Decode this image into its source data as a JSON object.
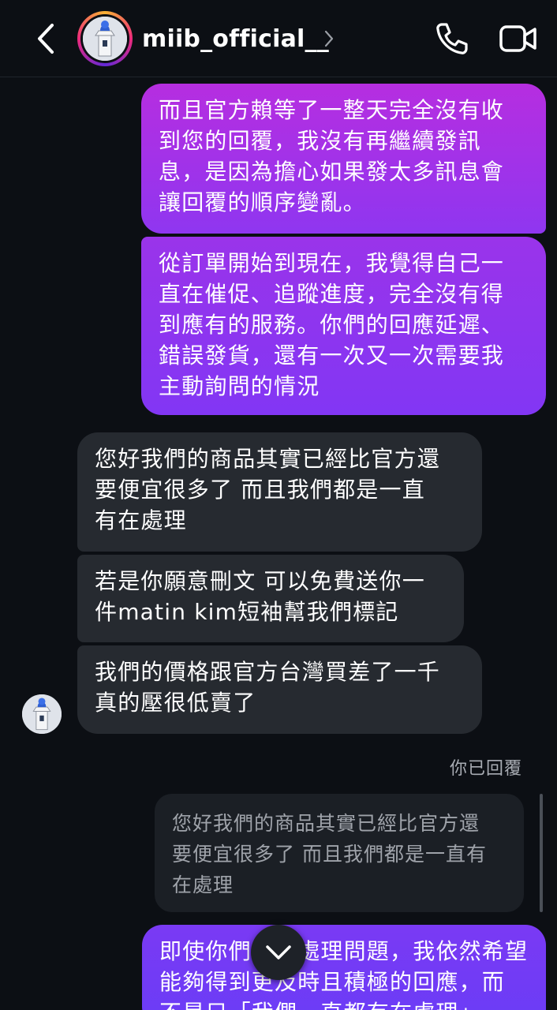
{
  "header": {
    "username": "miib_official__",
    "icons": {
      "back": "back-chevron-icon",
      "profile": "chevron-right-icon",
      "call": "phone-icon",
      "video": "video-camera-icon"
    }
  },
  "messages": [
    {
      "direction": "outgoing",
      "text": "而且官方賴等了一整天完全沒有收\n到您的回覆，我沒有再繼續發訊\n息，是因為擔心如果發太多訊息會\n讓回覆的順序變亂。"
    },
    {
      "direction": "outgoing",
      "text": "從訂單開始到現在，我覺得自己一\n直在催促、追蹤進度，完全沒有得\n到應有的服務。你們的回應延遲、\n錯誤發貨，還有一次又一次需要我\n主動詢問的情況"
    },
    {
      "direction": "incoming",
      "text": "您好我們的商品其實已經比官方還\n要便宜很多了 而且我們都是一直\n有在處理"
    },
    {
      "direction": "incoming",
      "text": "若是你願意刪文 可以免費送你一\n件matin kim短袖幫我們標記"
    },
    {
      "direction": "incoming",
      "text": "我們的價格跟官方台灣買差了一千\n真的壓很低賣了"
    }
  ],
  "reply": {
    "label": "你已回覆",
    "quoted_text": "您好我們的商品其實已經比官方還\n要便宜很多了 而且我們都是一直有\n在處理"
  },
  "last_message": {
    "direction": "outgoing",
    "text": "即使你們正在處理問題，我依然希望\n能夠得到更及時且積極的回應，而\n不是只「我們一直都有在處理」"
  },
  "colors": {
    "background": "#0c0f14",
    "outgoing_bubble": "#a032e8",
    "incoming_bubble": "#262a30",
    "quote_bubble": "#1b1f25"
  }
}
